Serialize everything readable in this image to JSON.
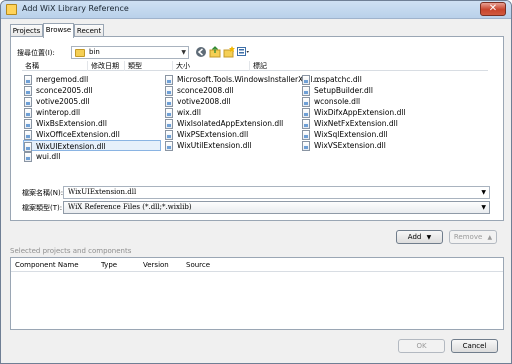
{
  "window": {
    "title": "Add WiX Library Reference",
    "close_glyph": "✕"
  },
  "tabs": [
    {
      "label": "Projects"
    },
    {
      "label": "Browse"
    },
    {
      "label": "Recent"
    }
  ],
  "browse": {
    "look_in_label": "搜尋位置(I):",
    "look_in_value": "bin",
    "columns": [
      "名稱",
      "修改日期",
      "類型",
      "大小",
      "標記"
    ],
    "files": [
      "mergemod.dll",
      "sconce2005.dll",
      "votive2005.dll",
      "winterop.dll",
      "WixBsExtension.dll",
      "WixOfficeExtension.dll",
      "WixUIExtension.dll",
      "wui.dll",
      "Microsoft.Tools.WindowsInstallerXml...",
      "sconce2008.dll",
      "votive2008.dll",
      "wix.dll",
      "WixIsolatedAppExtension.dll",
      "WixPSExtension.dll",
      "WixUtilExtension.dll",
      "mspatchc.dll",
      "SetupBuilder.dll",
      "wconsole.dll",
      "WixDifxAppExtension.dll",
      "WixNetFxExtension.dll",
      "WixSqlExtension.dll",
      "WixVSExtension.dll"
    ],
    "selected_file": "WixUIExtension.dll",
    "filename_label": "檔案名稱(N):",
    "filename_value": "WixUIExtension.dll",
    "filetype_label": "檔案類型(T):",
    "filetype_value": "WiX Reference Files (*.dll;*.wixlib)"
  },
  "actions": {
    "add_label": "Add",
    "remove_label": "Remove"
  },
  "selected_section": {
    "label": "Selected projects and components",
    "columns": [
      "Component Name",
      "Type",
      "Version",
      "Source"
    ]
  },
  "footer": {
    "ok_label": "OK",
    "cancel_label": "Cancel"
  },
  "colors": {
    "accent": "#8ab4e3",
    "title_bar": "#b9d1ea",
    "close_red": "#c8442c"
  }
}
